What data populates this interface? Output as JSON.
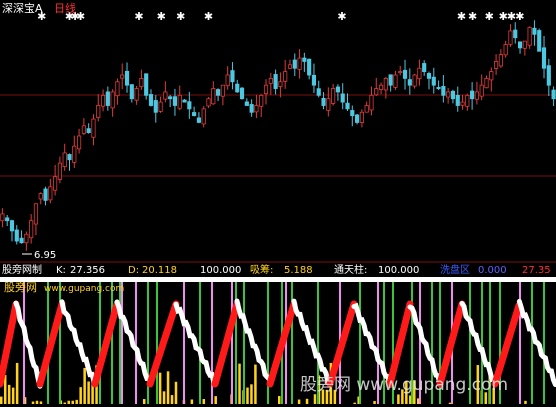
{
  "colors": {
    "background": "#000000",
    "up_candle": "#e03c3c",
    "down_candle": "#4ec8e0",
    "grid": "#7a1010",
    "hot": "#ff1a1a",
    "cool": "#ffffff",
    "vol": "#ffd21e",
    "buy_line": "#3ac43a",
    "sell_line": "#f08cf0",
    "watermark": "#e8e8e8"
  },
  "header": {
    "stock_name": "深深宝A",
    "period": "日线"
  },
  "indicator_bar": {
    "name": "股旁网制",
    "k_label": "K:",
    "k_value": "27.356",
    "d_label": "D:",
    "d_value": "20.118",
    "level_value": "100.000",
    "xichou_label": "吸筹:",
    "xichou_value": "5.188",
    "tongtian_label": "通天柱:",
    "tongtian_value": "100.000",
    "hidden_label": "洗盘区",
    "hidden_value_1": "0.000",
    "hidden_value_2": "27.35"
  },
  "logo_text": "股旁网",
  "logo_url": "www.gupang.com",
  "low_marker": "6.95",
  "watermark": "股旁网 www.gupang.com",
  "chart_data": [
    {
      "type": "candlestick",
      "title": "深深宝A 日线",
      "annotations": [
        "6.95"
      ],
      "note_markers": "white star markers along top edge",
      "close": [
        7.8,
        7.6,
        7.3,
        7.0,
        6.95,
        7.2,
        7.6,
        8.1,
        8.4,
        8.2,
        8.6,
        8.9,
        9.3,
        9.6,
        9.4,
        9.8,
        10.1,
        10.4,
        10.2,
        10.6,
        11.0,
        11.3,
        11.0,
        11.4,
        11.7,
        11.9,
        11.6,
        11.2,
        11.5,
        11.8,
        11.3,
        11.0,
        10.8,
        11.1,
        11.4,
        11.2,
        11.0,
        11.3,
        11.1,
        10.9,
        10.7,
        10.5,
        10.9,
        11.2,
        11.5,
        11.3,
        11.6,
        11.9,
        11.7,
        11.4,
        11.2,
        11.0,
        10.8,
        11.0,
        11.3,
        11.6,
        11.8,
        11.5,
        11.7,
        12.0,
        12.2,
        12.1,
        12.4,
        12.3,
        11.9,
        11.6,
        11.3,
        11.0,
        11.2,
        11.5,
        11.4,
        11.1,
        10.9,
        10.7,
        10.5,
        10.8,
        11.0,
        11.3,
        11.5,
        11.6,
        11.8,
        11.6,
        11.9,
        12.0,
        11.8,
        11.6,
        11.9,
        12.1,
        12.0,
        11.8,
        11.6,
        11.5,
        11.3,
        11.4,
        11.2,
        11.0,
        11.1,
        11.3,
        11.2,
        11.4,
        11.6,
        11.8,
        12.0,
        12.3,
        12.5,
        12.8,
        13.2,
        13.0,
        12.7,
        12.9,
        13.3,
        13.1,
        12.6,
        12.1,
        11.6,
        11.2
      ],
      "ylim": [
        6.5,
        13.7
      ]
    },
    {
      "type": "area",
      "title": "股旁网制",
      "series": [
        {
          "name": "K",
          "last_value": 27.356
        },
        {
          "name": "D",
          "last_value": 20.118
        },
        {
          "name": "吸筹",
          "last_value": 5.188
        },
        {
          "name": "通天柱",
          "last_value": 100.0
        }
      ],
      "ylim": [
        0,
        100
      ]
    }
  ]
}
